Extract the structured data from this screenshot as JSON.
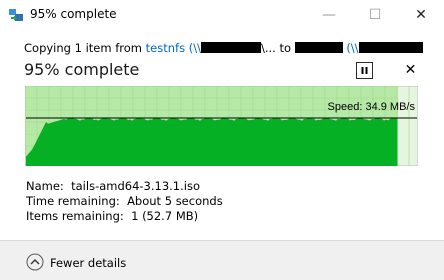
{
  "window": {
    "title": "95% complete",
    "minimize_glyph": "—",
    "maximize_glyph": "☐",
    "close_glyph": "✕"
  },
  "copy": {
    "prefix": "Copying 1 item from ",
    "source_link": "testnfs (\\\\",
    "source_tail": "\\... to ",
    "dest_link": "(\\\\"
  },
  "progress": {
    "heading": "95% complete",
    "percent": 95,
    "pause_icon": "pause-icon",
    "cancel_glyph": "✕"
  },
  "graph": {
    "speed_label": "Speed: 34.9 MB/s",
    "fill_color": "#06b025",
    "background_color": "#b6e9a6"
  },
  "details": {
    "name_label": "Name:",
    "name_value": "tails-amd64-3.13.1.iso",
    "time_label": "Time remaining:",
    "time_value": "About 5 seconds",
    "items_label": "Items remaining:",
    "items_value": "1 (52.7 MB)"
  },
  "footer": {
    "fewer_label": "Fewer details"
  }
}
